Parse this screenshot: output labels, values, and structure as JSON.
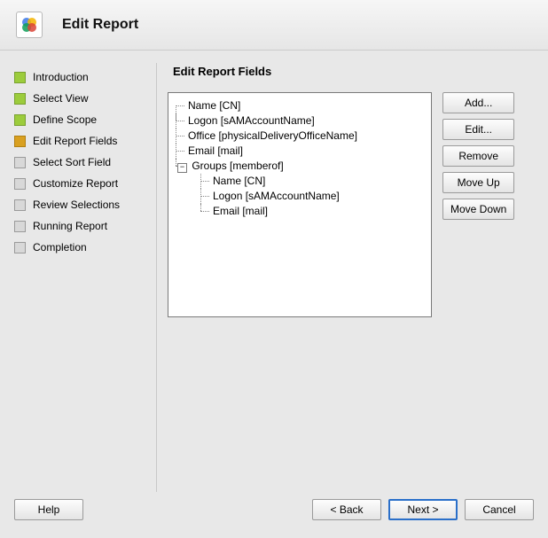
{
  "header": {
    "title": "Edit Report"
  },
  "steps": [
    {
      "label": "Introduction",
      "state": "done"
    },
    {
      "label": "Select View",
      "state": "done"
    },
    {
      "label": "Define Scope",
      "state": "done"
    },
    {
      "label": "Edit Report Fields",
      "state": "active"
    },
    {
      "label": "Select Sort Field",
      "state": "todo"
    },
    {
      "label": "Customize Report",
      "state": "todo"
    },
    {
      "label": "Review Selections",
      "state": "todo"
    },
    {
      "label": "Running Report",
      "state": "todo"
    },
    {
      "label": "Completion",
      "state": "todo"
    }
  ],
  "main": {
    "title": "Edit Report Fields",
    "fields": [
      {
        "label": "Name [CN]"
      },
      {
        "label": "Logon [sAMAccountName]"
      },
      {
        "label": "Office [physicalDeliveryOfficeName]"
      },
      {
        "label": "Email [mail]"
      },
      {
        "label": "Groups [memberof]",
        "expanded": true,
        "children": [
          {
            "label": "Name [CN]"
          },
          {
            "label": "Logon [sAMAccountName]"
          },
          {
            "label": "Email [mail]"
          }
        ]
      }
    ]
  },
  "field_buttons": {
    "add": "Add...",
    "edit": "Edit...",
    "remove": "Remove",
    "up": "Move Up",
    "down": "Move Down"
  },
  "footer": {
    "help": "Help",
    "back": "< Back",
    "next": "Next >",
    "cancel": "Cancel"
  },
  "icons": {
    "expander_minus": "−"
  }
}
